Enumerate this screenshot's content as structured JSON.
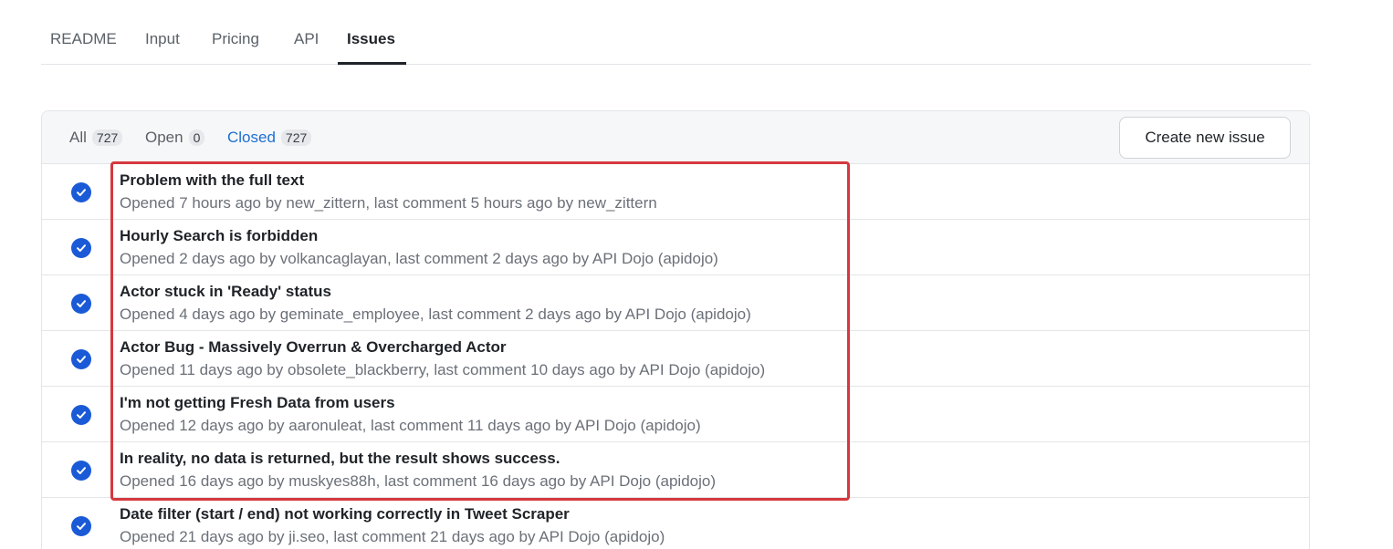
{
  "tabs": [
    {
      "label": "README"
    },
    {
      "label": "Input"
    },
    {
      "label": "Pricing"
    },
    {
      "label": "API"
    },
    {
      "label": "Issues"
    }
  ],
  "filters": {
    "all": {
      "label": "All",
      "count": "727"
    },
    "open": {
      "label": "Open",
      "count": "0"
    },
    "closed": {
      "label": "Closed",
      "count": "727"
    }
  },
  "create_button_label": "Create new issue",
  "issues": [
    {
      "title": "Problem with the full text",
      "meta": "Opened 7 hours ago by new_zittern, last comment 5 hours ago by new_zittern"
    },
    {
      "title": "Hourly Search is forbidden",
      "meta": "Opened 2 days ago by volkancaglayan, last comment 2 days ago by API Dojo (apidojo)"
    },
    {
      "title": "Actor stuck in 'Ready' status",
      "meta": "Opened 4 days ago by geminate_employee, last comment 2 days ago by API Dojo (apidojo)"
    },
    {
      "title": "Actor Bug - Massively Overrun & Overcharged Actor",
      "meta": "Opened 11 days ago by obsolete_blackberry, last comment 10 days ago by API Dojo (apidojo)"
    },
    {
      "title": "I'm not getting Fresh Data from users",
      "meta": "Opened 12 days ago by aaronuleat, last comment 11 days ago by API Dojo (apidojo)"
    },
    {
      "title": "In reality, no data is returned, but the result shows success.",
      "meta": "Opened 16 days ago by muskyes88h, last comment 16 days ago by API Dojo (apidojo)"
    },
    {
      "title": "Date filter (start / end) not working correctly in Tweet Scraper",
      "meta": "Opened 21 days ago by ji.seo, last comment 21 days ago by API Dojo (apidojo)"
    }
  ],
  "colors": {
    "accent": "#1e6fd1",
    "closed_icon": "#1a5ad7",
    "highlight": "#d5383f"
  }
}
